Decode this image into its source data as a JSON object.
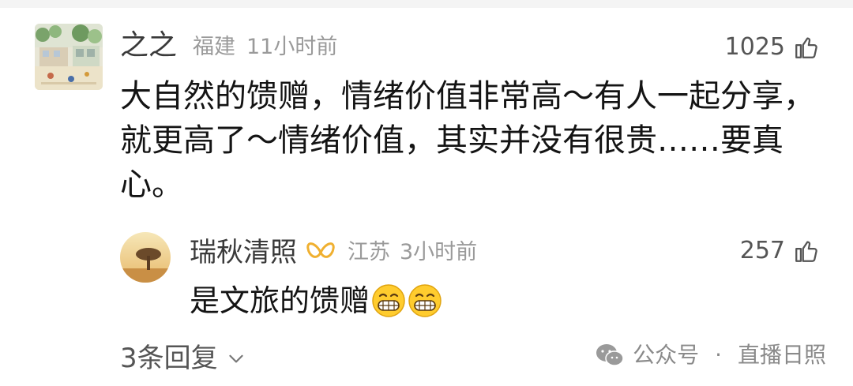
{
  "comment": {
    "username": "之之",
    "location": "福建",
    "time": "11小时前",
    "likes": "1025",
    "text": "大自然的馈赠，情绪价值非常高～有人一起分享，就更高了～情绪价值，其实并没有很贵……要真心。"
  },
  "reply": {
    "username": "瑞秋清照",
    "location": "江苏",
    "time": "3小时前",
    "likes": "257",
    "text": "是文旅的馈赠"
  },
  "footer": {
    "replies_label": "3条回复",
    "watermark_account": "公众号",
    "watermark_separator": "·",
    "watermark_name": "直播日照"
  },
  "icons": {
    "like": "thumbs-up-icon",
    "expand": "chevron-down-icon",
    "badge": "butterfly-badge-icon",
    "emoji": "grinning-face-icon",
    "wechat": "wechat-logo-icon"
  },
  "colors": {
    "primary_text": "#141414",
    "secondary_text": "#9a9a9a",
    "badge": "#f0b030",
    "emoji": "#ffcc2e"
  }
}
